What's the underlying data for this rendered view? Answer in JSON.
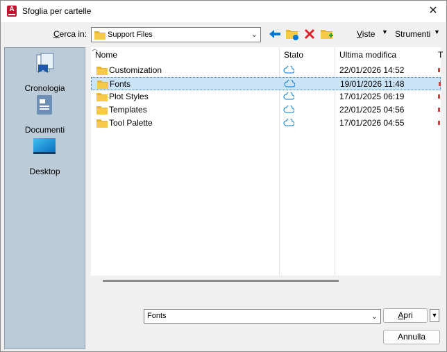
{
  "window": {
    "title": "Sfoglia per cartelle",
    "app_icon_letter": "A"
  },
  "toolbar": {
    "look_in_label_underlined": "C",
    "look_in_label_rest": "erca in:",
    "look_in_value": "Support Files",
    "views_label_underlined": "V",
    "views_label_rest": "iste",
    "tools_label": "Strumenti"
  },
  "places": [
    {
      "label": "Cronologia",
      "icon": "history-icon"
    },
    {
      "label": "Documenti",
      "icon": "documents-icon"
    },
    {
      "label": "Desktop",
      "icon": "desktop-icon"
    }
  ],
  "columns": {
    "name": "Nome",
    "status": "Stato",
    "modified": "Ultima modifica"
  },
  "files": [
    {
      "name": "Customization",
      "modified": "22/01/2026 14:52",
      "selected": false
    },
    {
      "name": "Fonts",
      "modified": "19/01/2026 11:48",
      "selected": true
    },
    {
      "name": "Plot Styles",
      "modified": "17/01/2025 06:19",
      "selected": false
    },
    {
      "name": "Templates",
      "modified": "22/01/2025 04:56",
      "selected": false
    },
    {
      "name": "Tool Palette",
      "modified": "17/01/2026 04:55",
      "selected": false
    }
  ],
  "footer": {
    "filename_value": "Fonts",
    "open_label_underlined": "A",
    "open_label_rest": "pri",
    "cancel_label": "Annulla"
  },
  "colors": {
    "accent": "#0078d4",
    "selection": "#cce4f7",
    "places_bg": "#bccbd8",
    "folder": "#f7c948",
    "delete": "#e0202a"
  }
}
